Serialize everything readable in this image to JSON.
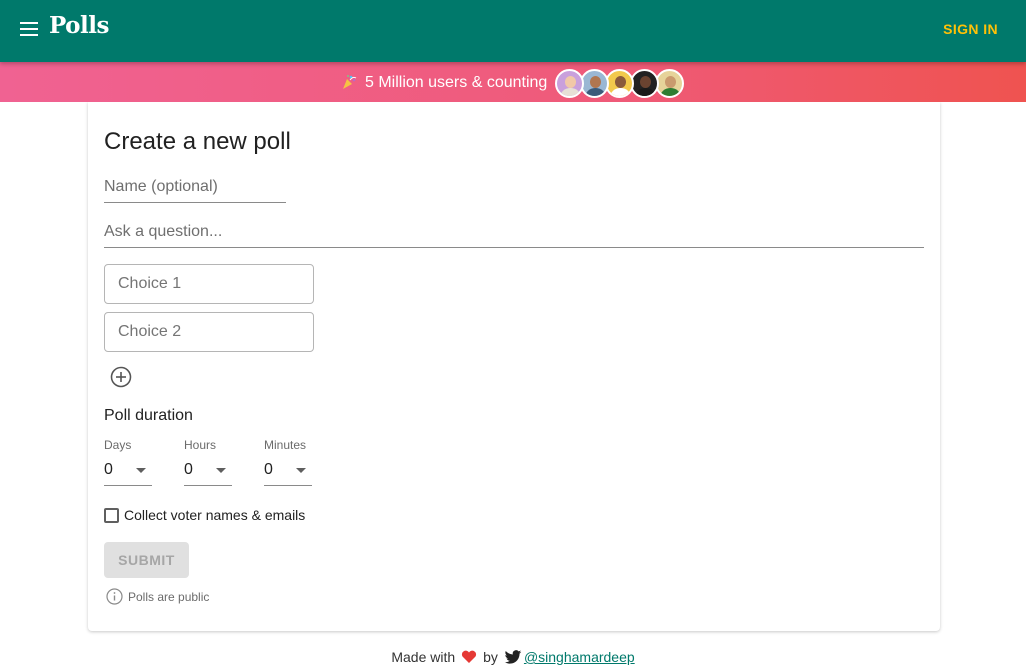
{
  "header": {
    "brand": "Polls",
    "sign_in_label": "SIGN IN"
  },
  "banner": {
    "text": "5 Million users & counting",
    "avatars": [
      {
        "bg": "#c9a0dc",
        "skin": "#f1c8a8",
        "shirt": "#e7e0d6"
      },
      {
        "bg": "#9ab7d3",
        "skin": "#b07650",
        "shirt": "#3b5b7a"
      },
      {
        "bg": "#f2c94c",
        "skin": "#8a5a3c",
        "shirt": "#ffffff"
      },
      {
        "bg": "#222222",
        "skin": "#6a4330",
        "shirt": "#1a1a1a"
      },
      {
        "bg": "#e6d39a",
        "skin": "#c99a6e",
        "shirt": "#2e7d32"
      }
    ]
  },
  "form": {
    "title": "Create a new poll",
    "name_placeholder": "Name (optional)",
    "question_placeholder": "Ask a question...",
    "choices": [
      {
        "placeholder": "Choice 1"
      },
      {
        "placeholder": "Choice 2"
      }
    ],
    "duration_title": "Poll duration",
    "duration": [
      {
        "label": "Days",
        "value": "0"
      },
      {
        "label": "Hours",
        "value": "0"
      },
      {
        "label": "Minutes",
        "value": "0"
      }
    ],
    "collect_label": "Collect voter names & emails",
    "collect_checked": false,
    "submit_label": "SUBMIT",
    "public_note": "Polls are public"
  },
  "footer": {
    "made_with": "Made with",
    "by": "by",
    "handle": "@singhamardeep"
  },
  "colors": {
    "primary": "#00796b",
    "accent": "#ffc107",
    "banner_start": "#f06292",
    "banner_end": "#ef5350",
    "heart": "#e53935"
  }
}
